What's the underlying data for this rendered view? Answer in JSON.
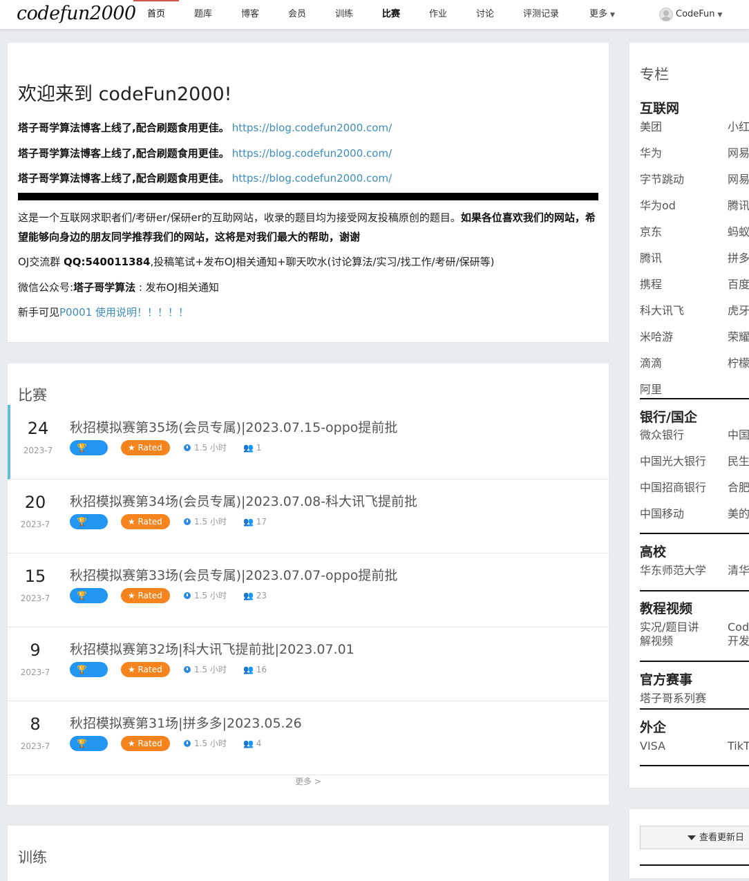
{
  "nav": {
    "logo": "codefun2000",
    "items": [
      "首页",
      "题库",
      "博客",
      "会员",
      "训练",
      "比赛",
      "作业",
      "讨论",
      "评测记录"
    ],
    "more_label": "更多",
    "user_name": "CodeFun"
  },
  "welcome": {
    "title": "欢迎来到 codeFun2000!",
    "blog_lines": [
      {
        "text": "塔子哥学算法博客上线了,配合刷题食用更佳。",
        "link": "https://blog.codefun2000.com/"
      },
      {
        "text": "塔子哥学算法博客上线了,配合刷题食用更佳。",
        "link": "https://blog.codefun2000.com/"
      },
      {
        "text": "塔子哥学算法博客上线了,配合刷题食用更佳。",
        "link": "https://blog.codefun2000.com/"
      }
    ],
    "intro_normal": "这是一个互联网求职者们/考研er/保研er的互助网站，收录的题目均为接受网友投稿原创的题目。",
    "intro_bold": "如果各位喜欢我们的网站，希望能够向身边的朋友同学推荐我们的网站，这将是对我们最大的帮助，谢谢",
    "qq_prefix": "OJ交流群 ",
    "qq_bold": "QQ:540011384",
    "qq_suffix": ",投稿笔试+发布OJ相关通知+聊天吹水(讨论算法/实习/找工作/考研/保研等)",
    "wechat_prefix": "微信公众号:",
    "wechat_bold": "塔子哥学算法",
    "wechat_suffix": " : 发布OJ相关通知",
    "newbie_prefix": "新手可见",
    "newbie_link": "P0001 使用说明！！！！！"
  },
  "contests": {
    "title": "比赛",
    "ioi_label": "IOI",
    "rated_label": "Rated",
    "more_label": "更多 >",
    "items": [
      {
        "day": "24",
        "month": "2023-7",
        "name": "秋招模拟赛第35场(会员专属)|2023.07.15-oppo提前批",
        "duration": "1.5 小时",
        "participants": "1"
      },
      {
        "day": "20",
        "month": "2023-7",
        "name": "秋招模拟赛第34场(会员专属)|2023.07.08-科大讯飞提前批",
        "duration": "1.5 小时",
        "participants": "17"
      },
      {
        "day": "15",
        "month": "2023-7",
        "name": "秋招模拟赛第33场(会员专属)|2023.07.07-oppo提前批",
        "duration": "1.5 小时",
        "participants": "23"
      },
      {
        "day": "9",
        "month": "2023-7",
        "name": "秋招模拟赛第32场|科大讯飞提前批|2023.07.01",
        "duration": "1.5 小时",
        "participants": "16"
      },
      {
        "day": "8",
        "month": "2023-7",
        "name": "秋招模拟赛第31场|拼多多|2023.05.26",
        "duration": "1.5 小时",
        "participants": "4"
      }
    ]
  },
  "training": {
    "title": "训练"
  },
  "sidebar": {
    "title": "专栏",
    "internet": {
      "label": "互联网",
      "col1": [
        "美团",
        "华为",
        "字节跳动",
        "华为od",
        "京东",
        "腾讯",
        "携程",
        "科大讯飞",
        "米哈游",
        "滴滴",
        "阿里"
      ],
      "col2": [
        "小红",
        "网易",
        "网易",
        "腾讯",
        "蚂蚁",
        "拼多",
        "百度",
        "虎牙",
        "荣耀",
        "柠檬"
      ]
    },
    "bank": {
      "label": "银行/国企",
      "col1": [
        "微众银行",
        "中国光大银行",
        "中国招商银行",
        "中国移动"
      ],
      "col2": [
        "中国",
        "民生",
        "合肥",
        "美的"
      ]
    },
    "univ": {
      "label": "高校",
      "col1": [
        "华东师范大学"
      ],
      "col2": [
        "清华"
      ]
    },
    "video": {
      "label": "教程视频",
      "col1": [
        "实况/题目讲",
        "解视频"
      ],
      "col2": [
        "Cod",
        "开发"
      ]
    },
    "official": {
      "label": "官方赛事",
      "col1": [
        "塔子哥系列赛"
      ]
    },
    "foreign": {
      "label": "外企",
      "col1": [
        "VISA"
      ],
      "col2": [
        "TikTo"
      ]
    },
    "updates_button": "查看更新日"
  }
}
